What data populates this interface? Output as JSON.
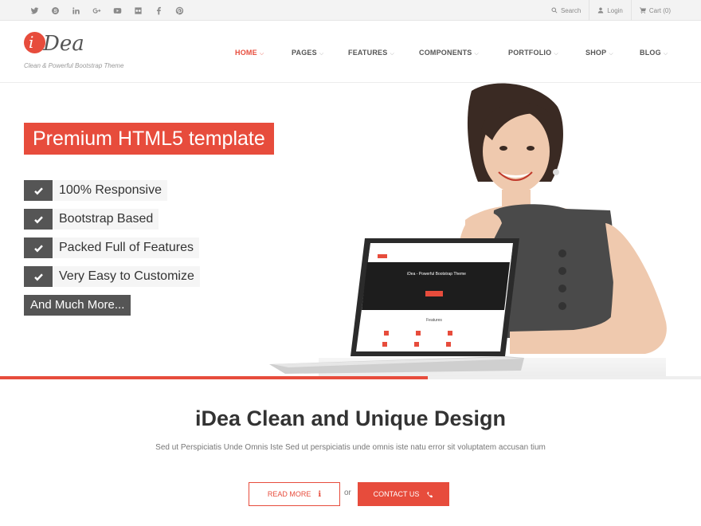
{
  "colors": {
    "accent": "#e74c3c",
    "dark": "#555555"
  },
  "topbar": {
    "social_icons": [
      "twitter-icon",
      "skype-icon",
      "linkedin-icon",
      "google-plus-icon",
      "youtube-icon",
      "flickr-icon",
      "facebook-icon",
      "pinterest-icon"
    ],
    "search_label": "Search",
    "login_label": "Login",
    "cart_label": "Cart (0)"
  },
  "header": {
    "logo_letter": "i",
    "logo_text": "Dea",
    "tagline": "Clean & Powerful Bootstrap Theme"
  },
  "nav": {
    "items": [
      {
        "label": "HOME",
        "active": true
      },
      {
        "label": "PAGES"
      },
      {
        "label": "FEATURES"
      },
      {
        "label": "COMPONENTS"
      },
      {
        "label": "PORTFOLIO"
      },
      {
        "label": "SHOP"
      },
      {
        "label": "BLOG"
      }
    ]
  },
  "hero": {
    "title": "Premium HTML5 template",
    "features": [
      "100% Responsive",
      "Bootstrap Based",
      "Packed Full of Features",
      "Very Easy to Customize"
    ],
    "more_label": "And Much More...",
    "screen_title": "iDea - Powerful Bootstrap Theme",
    "screen_section": "Features",
    "slide_progress": 0.61,
    "slide_dots": 3,
    "active_dot": 0
  },
  "section": {
    "title": "iDea Clean and Unique Design",
    "text": "Sed ut Perspiciatis Unde Omnis Iste Sed ut perspiciatis unde omnis iste natu error sit voluptatem accusan tium",
    "read_more_label": "READ MORE",
    "read_more_icon": "info-icon",
    "or_label": "or",
    "contact_label": "CONTACT US",
    "contact_icon": "phone-icon"
  }
}
